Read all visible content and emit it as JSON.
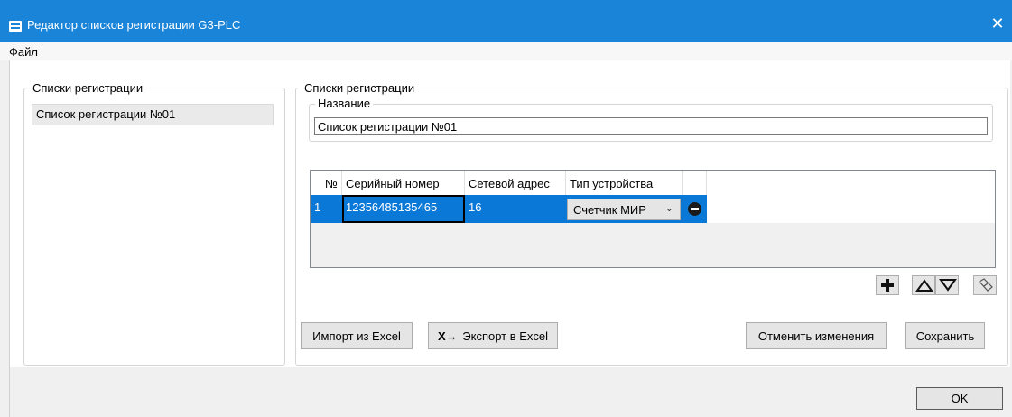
{
  "window": {
    "title": "Редактор списков регистрации G3-PLC",
    "close_symbol": "✕"
  },
  "menu": {
    "file": "Файл"
  },
  "left_panel": {
    "title": "Списки регистрации",
    "items": [
      "Список регистрации №01"
    ]
  },
  "right_panel": {
    "title": "Списки регистрации",
    "name_label": "Название",
    "name_value": "Список регистрации №01",
    "table": {
      "columns": [
        "№",
        "Серийный номер",
        "Сетевой адрес",
        "Тип устройства"
      ],
      "rows": [
        {
          "num": "1",
          "serial": "12356485135465",
          "address": "16",
          "device_type": "Счетчик МИР",
          "dropdown_symbol": "⌄"
        }
      ]
    },
    "tools": {
      "add_icon": "plus-icon",
      "up_icon": "triangle-up-icon",
      "down_icon": "triangle-down-icon",
      "clear_icon": "eraser-icon"
    },
    "buttons": {
      "import": "Импорт из Excel",
      "export_mark": "X→",
      "export": "Экспорт в Excel",
      "cancel": "Отменить изменения",
      "save": "Сохранить"
    }
  },
  "footer": {
    "ok": "OK"
  },
  "colors": {
    "titlebar": "#1a84d8",
    "selection": "#0a78d7"
  }
}
